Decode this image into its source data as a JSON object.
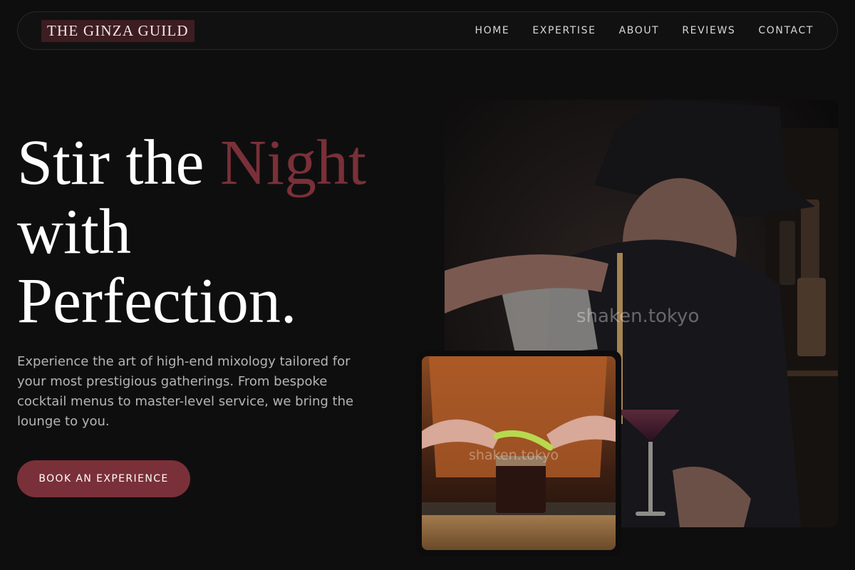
{
  "brand": "THE GINZA GUILD",
  "nav": {
    "links": [
      "HOME",
      "EXPERTISE",
      "ABOUT",
      "REVIEWS",
      "CONTACT"
    ]
  },
  "hero": {
    "headline_part1": "Stir the ",
    "headline_accent": "Night",
    "headline_line2": "with",
    "headline_line3": "Perfection.",
    "lede": "Experience the art of high-end mixology tailored for your most prestigious gatherings. From bespoke cocktail menus to master-level service, we bring the lounge to you.",
    "cta": "BOOK AN EXPERIENCE"
  },
  "images": {
    "main_watermark": "shaken.tokyo",
    "sub_watermark": "shaken.tokyo"
  },
  "colors": {
    "background": "#0f0e0f",
    "accent": "#7a3038",
    "brand_bg": "#3d1d22"
  }
}
